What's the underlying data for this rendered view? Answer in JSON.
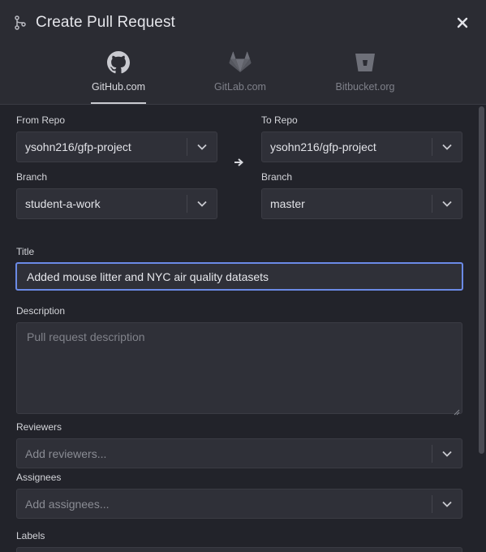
{
  "dialog": {
    "title": "Create Pull Request",
    "close_icon": "×"
  },
  "providers": [
    {
      "label": "GitHub.com",
      "icon": "github-icon",
      "active": true
    },
    {
      "label": "GitLab.com",
      "icon": "gitlab-icon",
      "active": false
    },
    {
      "label": "Bitbucket.org",
      "icon": "bitbucket-icon",
      "active": false
    }
  ],
  "form": {
    "from_repo": {
      "label": "From Repo",
      "value": "ysohn216/gfp-project"
    },
    "from_branch": {
      "label": "Branch",
      "value": "student-a-work"
    },
    "to_repo": {
      "label": "To Repo",
      "value": "ysohn216/gfp-project"
    },
    "to_branch": {
      "label": "Branch",
      "value": "master"
    },
    "title": {
      "label": "Title",
      "value": "Added mouse litter and NYC air quality datasets"
    },
    "description": {
      "label": "Description",
      "placeholder": "Pull request description"
    },
    "reviewers": {
      "label": "Reviewers",
      "placeholder": "Add reviewers..."
    },
    "assignees": {
      "label": "Assignees",
      "placeholder": "Add assignees..."
    },
    "labels": {
      "label": "Labels"
    }
  },
  "colors": {
    "header_bg": "#2b2c33",
    "content_bg": "#22232a",
    "field_bg": "#2f3038",
    "focus_border": "#6b8ae6"
  }
}
